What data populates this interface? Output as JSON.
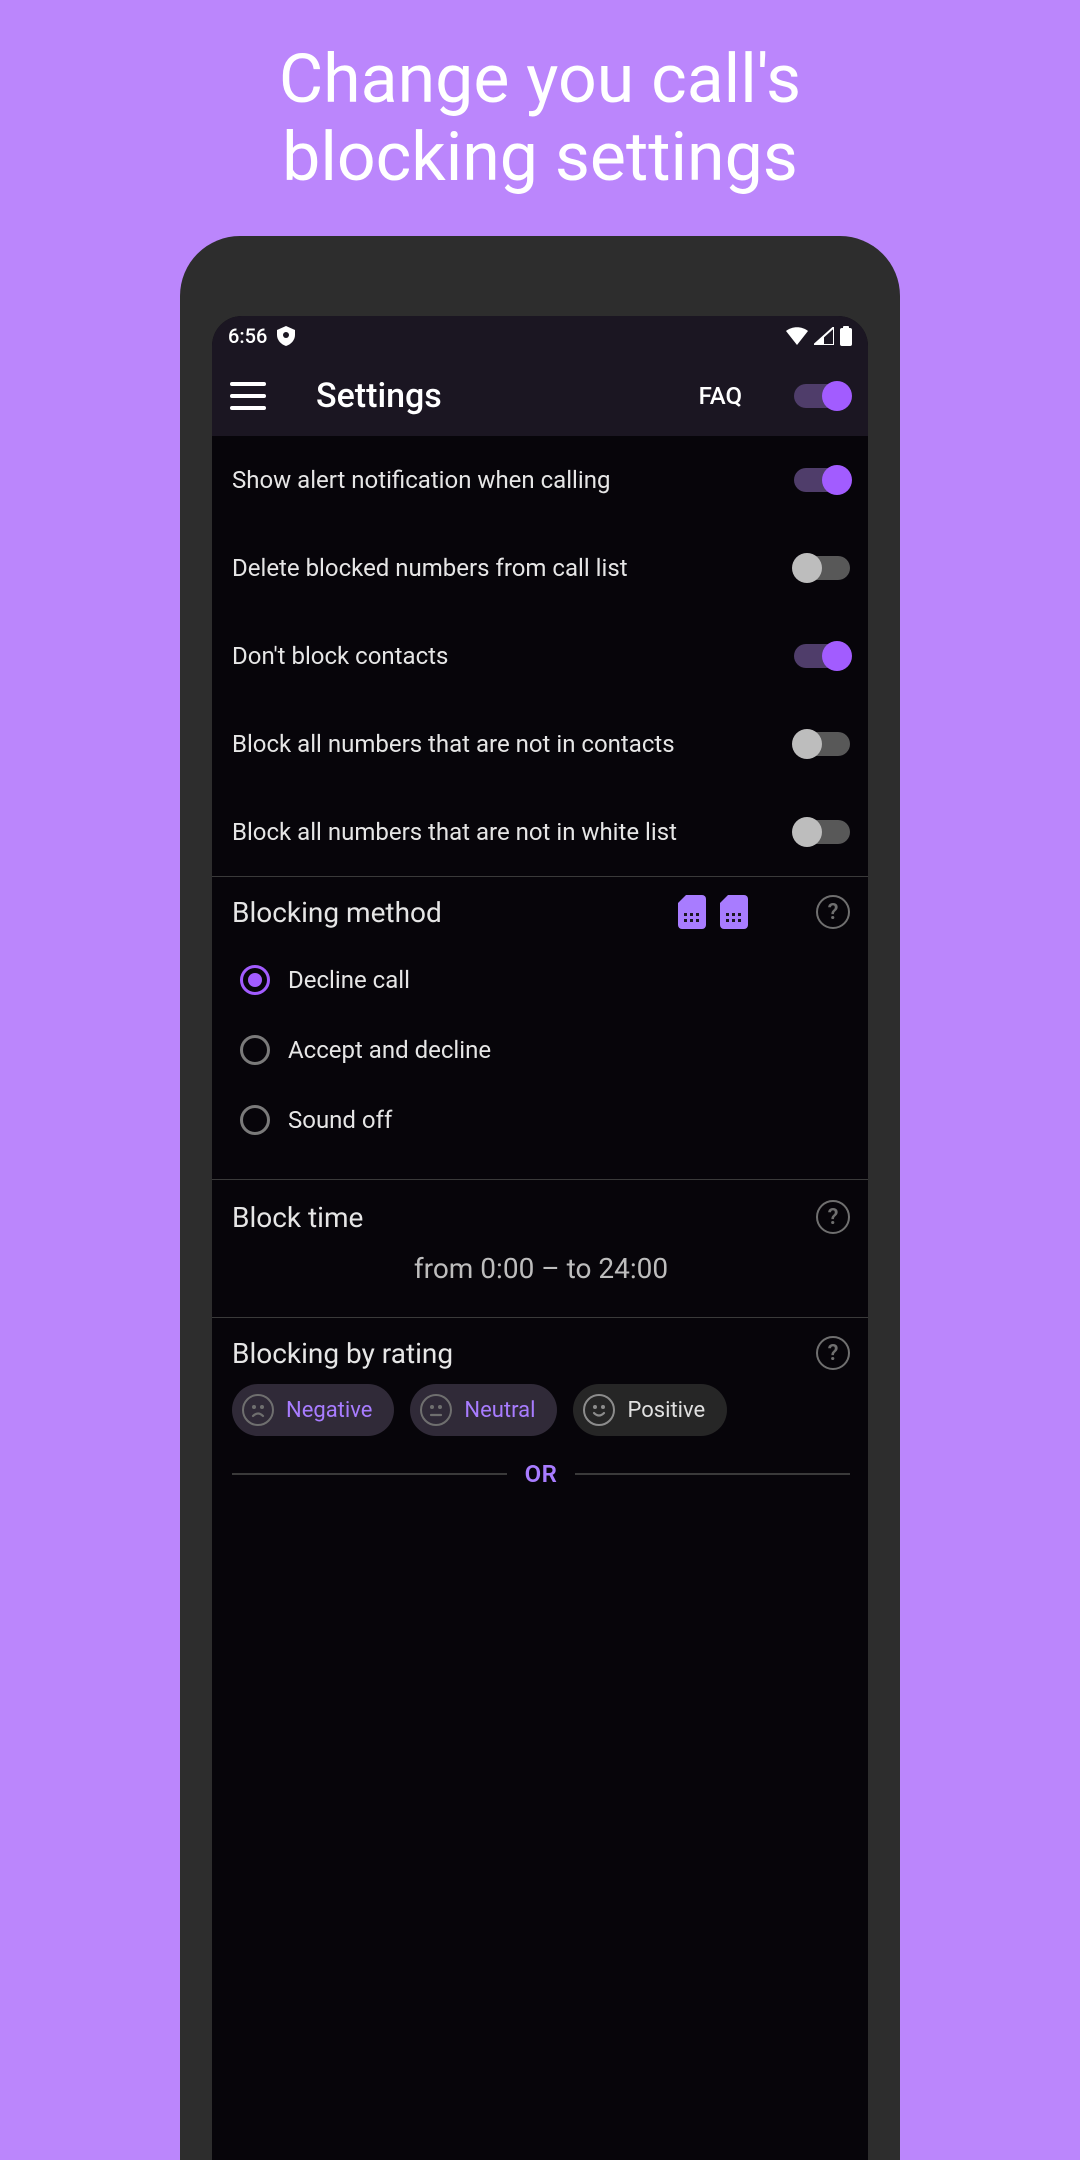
{
  "hero": {
    "line1": "Change you call's",
    "line2": "blocking settings"
  },
  "statusbar": {
    "time": "6:56"
  },
  "appbar": {
    "title": "Settings",
    "faq": "FAQ",
    "header_toggle_on": true
  },
  "settings": [
    {
      "label": "Show alert notification when calling",
      "on": true
    },
    {
      "label": "Delete blocked numbers from call list",
      "on": false
    },
    {
      "label": "Don't block contacts",
      "on": true
    },
    {
      "label": "Block all numbers that are not in contacts",
      "on": false
    },
    {
      "label": "Block all numbers that are not in white list",
      "on": false
    }
  ],
  "blocking_method": {
    "title": "Blocking method",
    "options": [
      {
        "label": "Decline call",
        "selected": true
      },
      {
        "label": "Accept and decline",
        "selected": false
      },
      {
        "label": "Sound off",
        "selected": false
      }
    ]
  },
  "block_time": {
    "title": "Block time",
    "value": "from 0:00 – to 24:00"
  },
  "blocking_by_rating": {
    "title": "Blocking by rating",
    "chips": [
      {
        "label": "Negative",
        "active": true
      },
      {
        "label": "Neutral",
        "active": true
      },
      {
        "label": "Positive",
        "active": false
      }
    ],
    "or_label": "OR"
  }
}
